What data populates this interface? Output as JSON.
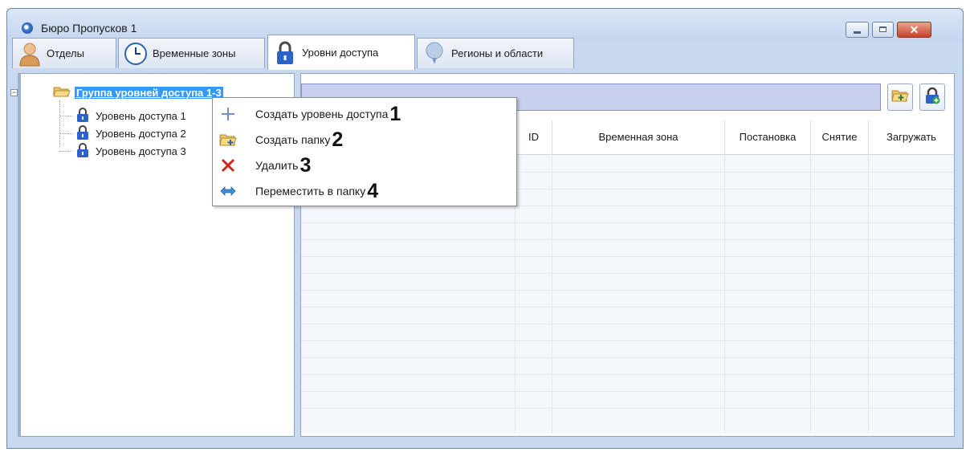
{
  "window": {
    "title": "Бюро Пропусков 1",
    "close_glyph": "✕"
  },
  "tabs": [
    {
      "label": "Отделы",
      "icon": "person-icon"
    },
    {
      "label": "Временные зоны",
      "icon": "clock-icon"
    },
    {
      "label": "Уровни доступа",
      "icon": "lock-icon",
      "active": true
    },
    {
      "label": "Регионы и области",
      "icon": "balloon-icon"
    }
  ],
  "tree": {
    "group": {
      "label": "Группа уровней доступа 1-3",
      "expander": "−"
    },
    "items": [
      {
        "label": "Уровень доступа 1"
      },
      {
        "label": "Уровень доступа 2"
      },
      {
        "label": "Уровень доступа 3"
      }
    ]
  },
  "grid": {
    "columns": [
      "ID",
      "Временная зона",
      "Постановка",
      "Снятие",
      "Загружать"
    ]
  },
  "context_menu": {
    "items": [
      {
        "label": "Создать уровень доступа",
        "number": "1",
        "icon": "plus-icon"
      },
      {
        "label": "Создать папку",
        "number": "2",
        "icon": "folder-add-icon"
      },
      {
        "label": "Удалить",
        "number": "3",
        "icon": "delete-x-icon"
      },
      {
        "label": "Переместить в папку",
        "number": "4",
        "icon": "move-arrows-icon"
      }
    ]
  },
  "colors": {
    "selection": "#3399ff",
    "toolbar": "#c9d0ef",
    "window_frame": "#c8d9ef"
  }
}
